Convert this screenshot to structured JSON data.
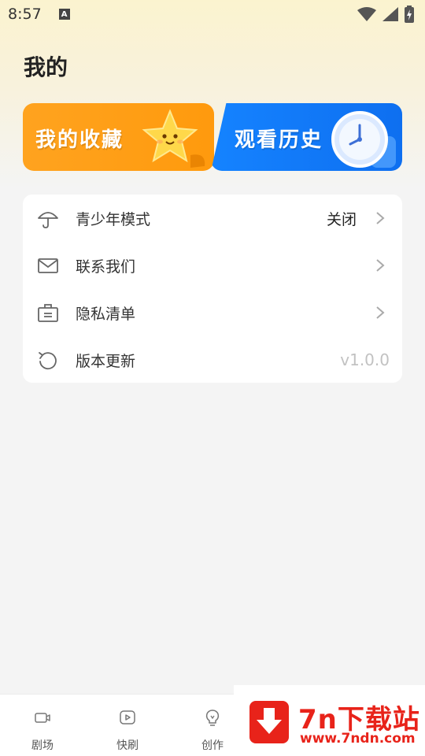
{
  "status_bar": {
    "time": "8:57",
    "notification_icon": "a-icon"
  },
  "page": {
    "title": "我的"
  },
  "cards": {
    "favorites": {
      "label": "我的收藏",
      "icon": "star-icon",
      "color": "#ff9f17"
    },
    "history": {
      "label": "观看历史",
      "icon": "clock-icon",
      "color": "#1278fa"
    }
  },
  "menu": {
    "items": [
      {
        "label": "青少年模式",
        "value": "关闭",
        "icon": "umbrella-icon"
      },
      {
        "label": "联系我们",
        "icon": "mail-icon"
      },
      {
        "label": "隐私清单",
        "icon": "briefcase-icon"
      },
      {
        "label": "版本更新",
        "value": "v1.0.0",
        "icon": "refresh-icon"
      }
    ]
  },
  "bottom_nav": {
    "items": [
      {
        "label": "剧场",
        "icon": "video-camera-icon"
      },
      {
        "label": "快刷",
        "icon": "play-icon"
      },
      {
        "label": "创作",
        "icon": "lightbulb-icon"
      }
    ]
  },
  "watermark": {
    "name": "7n下载站",
    "url": "www.7ndn.com",
    "color": "#e8231a"
  }
}
